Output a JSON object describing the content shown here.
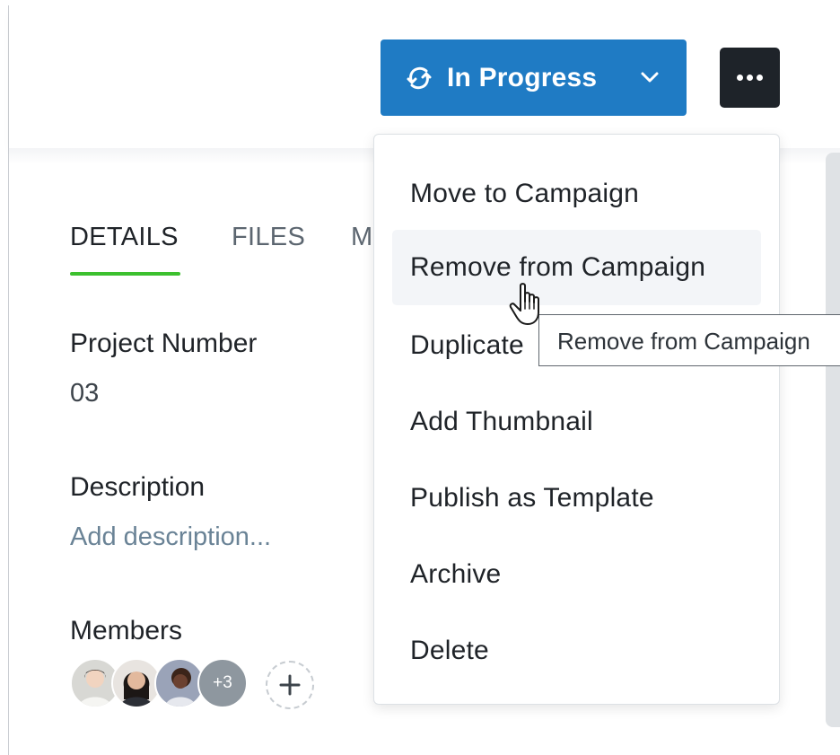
{
  "header": {
    "status_button": {
      "label": "In Progress",
      "color": "#1f7bc4"
    },
    "more_button": {
      "icon": "ellipsis-icon",
      "color": "#1e2329"
    }
  },
  "tabs": {
    "items": [
      {
        "label": "DETAILS",
        "active": true
      },
      {
        "label": "FILES",
        "active": false
      },
      {
        "label": "M",
        "active": false
      }
    ],
    "active_color": "#3cc02e"
  },
  "details": {
    "project_number": {
      "label": "Project Number",
      "value": "03"
    },
    "description": {
      "label": "Description",
      "placeholder": "Add description..."
    },
    "members": {
      "label": "Members",
      "overflow_count": "+3"
    }
  },
  "menu": {
    "items": [
      {
        "label": "Move to Campaign"
      },
      {
        "label": "Remove from Campaign",
        "hovered": true
      },
      {
        "label": "Duplicate"
      },
      {
        "label": "Add Thumbnail"
      },
      {
        "label": "Publish as Template"
      },
      {
        "label": "Archive"
      },
      {
        "label": "Delete"
      }
    ]
  },
  "tooltip": {
    "text": "Remove from Campaign"
  }
}
